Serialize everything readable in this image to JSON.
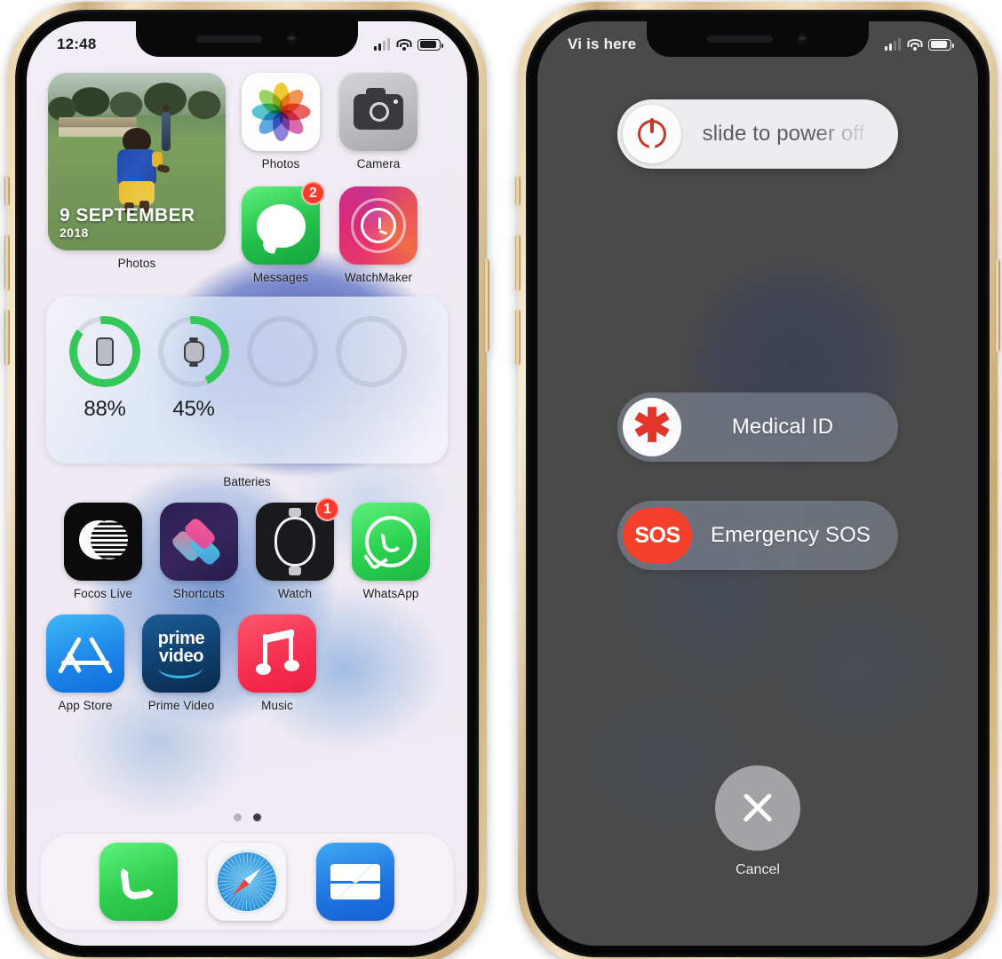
{
  "left_phone": {
    "status_bar": {
      "time": "12:48",
      "signal_icon": "cellular-bars-icon",
      "wifi_icon": "wifi-icon",
      "battery_icon": "battery-icon"
    },
    "photos_widget": {
      "date_line1": "9 SEPTEMBER",
      "date_line2": "2018",
      "label": "Photos"
    },
    "apps_row1": [
      {
        "label": "Photos",
        "icon": "photos-icon",
        "badge": ""
      },
      {
        "label": "Camera",
        "icon": "camera-icon",
        "badge": ""
      },
      {
        "label": "Messages",
        "icon": "messages-icon",
        "badge": "2"
      },
      {
        "label": "WatchMaker",
        "icon": "watchmaker-icon",
        "badge": ""
      }
    ],
    "batteries_widget": {
      "caption": "Batteries",
      "rings": [
        {
          "device": "iphone-glyph",
          "percent_label": "88%",
          "percent": 88,
          "color": "#34c759"
        },
        {
          "device": "watch-glyph",
          "percent_label": "45%",
          "percent": 45,
          "color": "#34c759"
        },
        {
          "device": "",
          "percent_label": "",
          "percent": 0,
          "color": ""
        },
        {
          "device": "",
          "percent_label": "",
          "percent": 0,
          "color": ""
        }
      ]
    },
    "apps_row2": [
      {
        "label": "Focos Live",
        "icon": "focos-live-icon",
        "badge": ""
      },
      {
        "label": "Shortcuts",
        "icon": "shortcuts-icon",
        "badge": ""
      },
      {
        "label": "Watch",
        "icon": "watch-icon",
        "badge": "1"
      },
      {
        "label": "WhatsApp",
        "icon": "whatsapp-icon",
        "badge": ""
      }
    ],
    "apps_row3": [
      {
        "label": "App Store",
        "icon": "app-store-icon",
        "badge": ""
      },
      {
        "label": "Prime Video",
        "icon": "prime-video-icon",
        "badge": "",
        "text1": "prime",
        "text2": "video"
      },
      {
        "label": "Music",
        "icon": "music-icon",
        "badge": ""
      }
    ],
    "page_dots": {
      "count": 2,
      "active_index": 1
    },
    "dock": [
      {
        "label": "Phone",
        "icon": "phone-icon"
      },
      {
        "label": "Safari",
        "icon": "safari-icon"
      },
      {
        "label": "Mail",
        "icon": "mail-icon"
      }
    ]
  },
  "right_phone": {
    "status_bar": {
      "carrier": "Vi is here",
      "signal_icon": "cellular-bars-icon",
      "wifi_icon": "wifi-icon",
      "battery_icon": "battery-icon"
    },
    "power_slider": {
      "label": "slide to power off",
      "icon": "power-icon"
    },
    "medical_id": {
      "label": "Medical ID",
      "icon": "medical-asterisk-icon",
      "glyph": "✱"
    },
    "emergency_sos": {
      "label": "Emergency SOS",
      "icon": "sos-icon",
      "glyph": "SOS"
    },
    "cancel": {
      "label": "Cancel",
      "icon": "close-x-icon"
    }
  },
  "colors": {
    "battery_green": "#34c759",
    "power_red": "#c0392b",
    "medical_red": "#e2362b",
    "sos_red": "#f5402c",
    "badge_red": "#ff3b30"
  }
}
